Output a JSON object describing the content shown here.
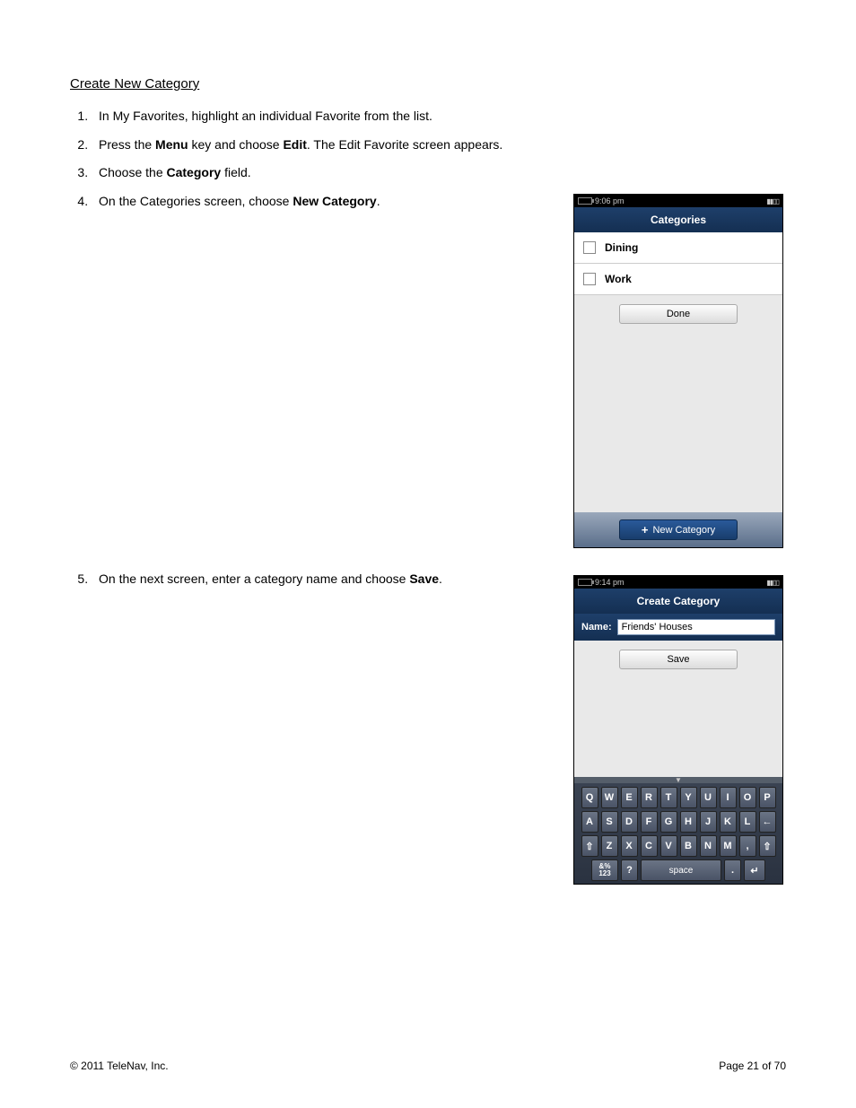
{
  "section_title": "Create New Category",
  "steps": [
    {
      "pre": "In My Favorites, highlight an individual Favorite from the list."
    },
    {
      "pre": "Press the ",
      "b1": "Menu",
      "mid": " key and choose ",
      "b2": "Edit",
      "post": ". The Edit Favorite screen appears."
    },
    {
      "pre": "Choose the ",
      "b1": "Category",
      "post": " field."
    },
    {
      "pre": "On the Categories screen, choose ",
      "b1": "New Category",
      "post": "."
    },
    {
      "pre": "On the next screen, enter a category name and choose ",
      "b1": "Save",
      "post": "."
    }
  ],
  "phone1": {
    "time": "9:06 pm",
    "title": "Categories",
    "rows": [
      "Dining",
      "Work"
    ],
    "done_btn": "Done",
    "new_btn": "New Category"
  },
  "phone2": {
    "time": "9:14 pm",
    "title": "Create Category",
    "name_label": "Name:",
    "name_value": "Friends' Houses",
    "save_btn": "Save",
    "kb": {
      "row1": [
        "Q",
        "W",
        "E",
        "R",
        "T",
        "Y",
        "U",
        "I",
        "O",
        "P"
      ],
      "row2": [
        "A",
        "S",
        "D",
        "F",
        "G",
        "H",
        "J",
        "K",
        "L"
      ],
      "back": "←",
      "shift": "⇧",
      "row3": [
        "Z",
        "X",
        "C",
        "V",
        "B",
        "N",
        "M"
      ],
      "comma": ",",
      "shift2": "⇧",
      "sym": "&%\n123",
      "qmark": "?",
      "space": "space",
      "period": ".",
      "enter": "↵"
    }
  },
  "footer": {
    "copyright": "© 2011 TeleNav, Inc.",
    "page": "Page 21 of 70"
  }
}
